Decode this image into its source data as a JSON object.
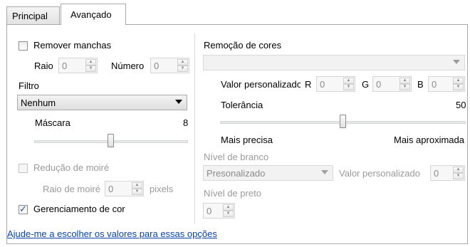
{
  "tabs": [
    {
      "label": "Principal",
      "active": false
    },
    {
      "label": "Avançado",
      "active": true
    }
  ],
  "left": {
    "remove_spots": {
      "label": "Remover manchas",
      "checked": false
    },
    "radius": {
      "label": "Raio",
      "value": "0"
    },
    "number": {
      "label": "Número",
      "value": "0"
    },
    "filter": {
      "label": "Filtro",
      "selected": "Nenhum"
    },
    "mask": {
      "label": "Máscara",
      "value": "8",
      "level_fraction": 0.5
    },
    "moire_reduction": {
      "label": "Redução de moiré",
      "checked": false,
      "enabled": false
    },
    "moire_radius": {
      "label": "Raio de moiré",
      "value": "0",
      "unit": "pixels"
    },
    "color_management": {
      "label": "Gerenciamento de cor",
      "checked": true
    }
  },
  "right": {
    "color_removal": {
      "label": "Remoção de cores",
      "selected": ""
    },
    "custom_value": {
      "label": "Valor personalizado",
      "r_label": "R",
      "r": "0",
      "g_label": "G",
      "g": "0",
      "b_label": "B",
      "b": "0"
    },
    "tolerance": {
      "label": "Tolerância",
      "value": "50",
      "level_fraction": 0.5,
      "min_label": "Mais precisa",
      "max_label": "Mais aproximada"
    },
    "white_level": {
      "label": "Nível de branco",
      "selected": "Presonalizado",
      "custom_label": "Valor personalizado",
      "custom_value": "0"
    },
    "black_level": {
      "label": "Nível de preto",
      "value": "0"
    }
  },
  "help_link": "Ajude-me a escolher os valores para essas opções",
  "colors": {
    "link": "#0645ad",
    "check": "#1f4e99",
    "disabled_text": "#9a9a9a"
  },
  "icons": {
    "spin_up": "▲",
    "spin_down": "▼"
  }
}
